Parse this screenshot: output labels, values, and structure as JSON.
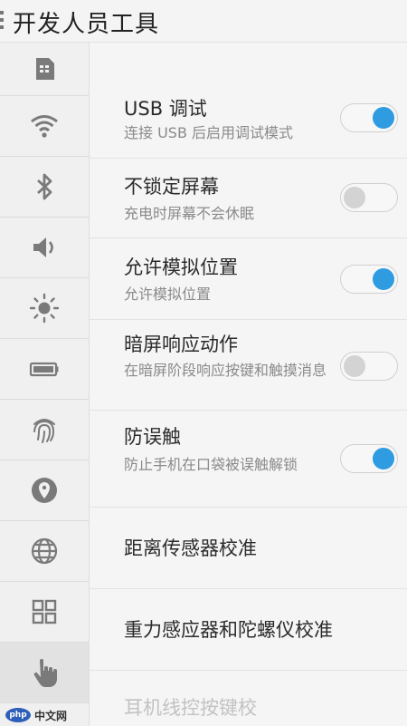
{
  "header": {
    "title": "开发人员工具"
  },
  "sidebar": {
    "items": [
      {
        "icon": "sim-card-icon"
      },
      {
        "icon": "wifi-icon"
      },
      {
        "icon": "bluetooth-icon"
      },
      {
        "icon": "volume-icon"
      },
      {
        "icon": "brightness-icon"
      },
      {
        "icon": "battery-icon"
      },
      {
        "icon": "fingerprint-icon"
      },
      {
        "icon": "location-icon"
      },
      {
        "icon": "globe-icon"
      },
      {
        "icon": "apps-grid-icon"
      },
      {
        "icon": "hand-pointer-icon",
        "active": true
      }
    ]
  },
  "settings": [
    {
      "title": "USB 调试",
      "subtitle": "连接 USB 后启用调试模式",
      "toggle": "on"
    },
    {
      "title": "不锁定屏幕",
      "subtitle": "充电时屏幕不会休眠",
      "toggle": "off"
    },
    {
      "title": "允许模拟位置",
      "subtitle": "允许模拟位置",
      "toggle": "on"
    },
    {
      "title": "暗屏响应动作",
      "subtitle": "在暗屏阶段响应按键和触摸消息",
      "toggle": "off"
    },
    {
      "title": "防误触",
      "subtitle": "防止手机在口袋被误触解锁",
      "toggle": "on"
    },
    {
      "title": "距离传感器校准"
    },
    {
      "title": "重力感应器和陀螺仪校准"
    },
    {
      "title": "耳机线控按键校"
    }
  ],
  "watermark": {
    "logo": "php",
    "text": "中文网"
  },
  "colors": {
    "accent": "#2f9be0"
  }
}
